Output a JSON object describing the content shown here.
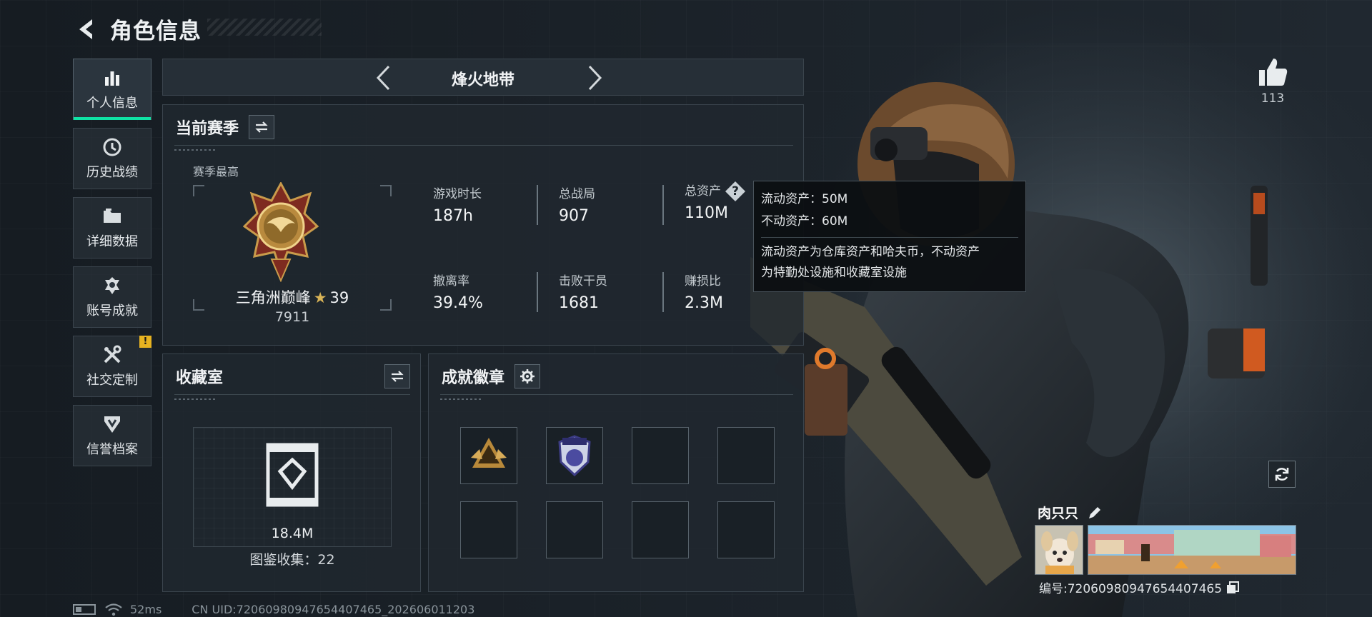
{
  "header": {
    "title": "角色信息"
  },
  "sidebar": {
    "items": [
      {
        "label": "个人信息",
        "icon": "bar-chart-icon",
        "active": true
      },
      {
        "label": "历史战绩",
        "icon": "history-icon"
      },
      {
        "label": "详细数据",
        "icon": "folder-icon"
      },
      {
        "label": "账号成就",
        "icon": "achievement-icon"
      },
      {
        "label": "社交定制",
        "icon": "tools-icon",
        "badge": "!"
      },
      {
        "label": "信誉档案",
        "icon": "shield-icon"
      }
    ]
  },
  "mode": {
    "title": "烽火地带"
  },
  "season": {
    "title": "当前赛季",
    "best_label": "赛季最高",
    "rank_name": "三角洲巅峰",
    "rank_star": "★",
    "rank_stars": "39",
    "rank_score": "7911",
    "stats": [
      {
        "label": "游戏时长",
        "value": "187h"
      },
      {
        "label": "总战局",
        "value": "907"
      },
      {
        "label": "总资产",
        "value": "110M",
        "help": "?"
      },
      {
        "label": "撤离率",
        "value": "39.4%"
      },
      {
        "label": "击败干员",
        "value": "1681"
      },
      {
        "label": "赚损比",
        "value": "2.3M"
      }
    ]
  },
  "tooltip": {
    "liquid": "流动资产：50M",
    "fixed": "不动资产：60M",
    "desc_line1": "流动资产为仓库资产和哈夫币，不动资产",
    "desc_line2": "为特勤处设施和收藏室设施"
  },
  "collection": {
    "title": "收藏室",
    "value": "18.4M",
    "count": "图鉴收集：22"
  },
  "badges": {
    "title": "成就徽章"
  },
  "profile": {
    "likes": "113",
    "name": "肉只只",
    "id": "编号:72060980947654407465"
  },
  "status": {
    "ping": "52ms",
    "uid": "CN UID:72060980947654407465_202606011203"
  },
  "colors": {
    "accent": "#0fe3a5",
    "gold": "#d9b457",
    "warning": "#e6b221"
  }
}
